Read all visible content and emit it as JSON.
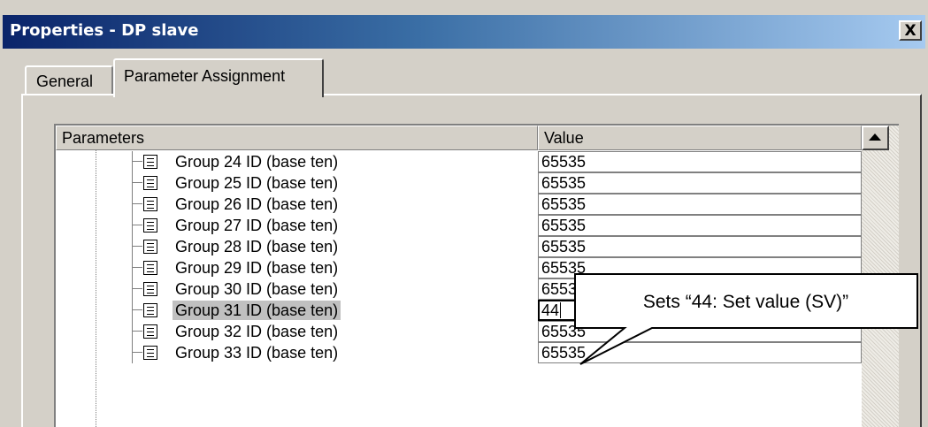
{
  "window": {
    "title": "Properties - DP slave",
    "close_label": "X"
  },
  "tabs": [
    {
      "label": "General"
    },
    {
      "label": "Parameter Assignment"
    }
  ],
  "grid": {
    "headers": {
      "parameters": "Parameters",
      "value": "Value"
    },
    "rows": [
      {
        "label": "Group 24 ID (base ten)",
        "value": "65535"
      },
      {
        "label": "Group 25 ID (base ten)",
        "value": "65535"
      },
      {
        "label": "Group 26 ID (base ten)",
        "value": "65535"
      },
      {
        "label": "Group 27 ID (base ten)",
        "value": "65535"
      },
      {
        "label": "Group 28 ID (base ten)",
        "value": "65535"
      },
      {
        "label": "Group 29 ID (base ten)",
        "value": "65535"
      },
      {
        "label": "Group 30 ID (base ten)",
        "value": "65535"
      },
      {
        "label": "Group 31 ID (base ten)",
        "value": "44"
      },
      {
        "label": "Group 32 ID (base ten)",
        "value": "65535"
      },
      {
        "label": "Group 33 ID (base ten)",
        "value": "65535"
      }
    ],
    "selected_row": "Group 31 ID (base ten)"
  },
  "callout": {
    "text": "Sets “44: Set value (SV)”"
  }
}
